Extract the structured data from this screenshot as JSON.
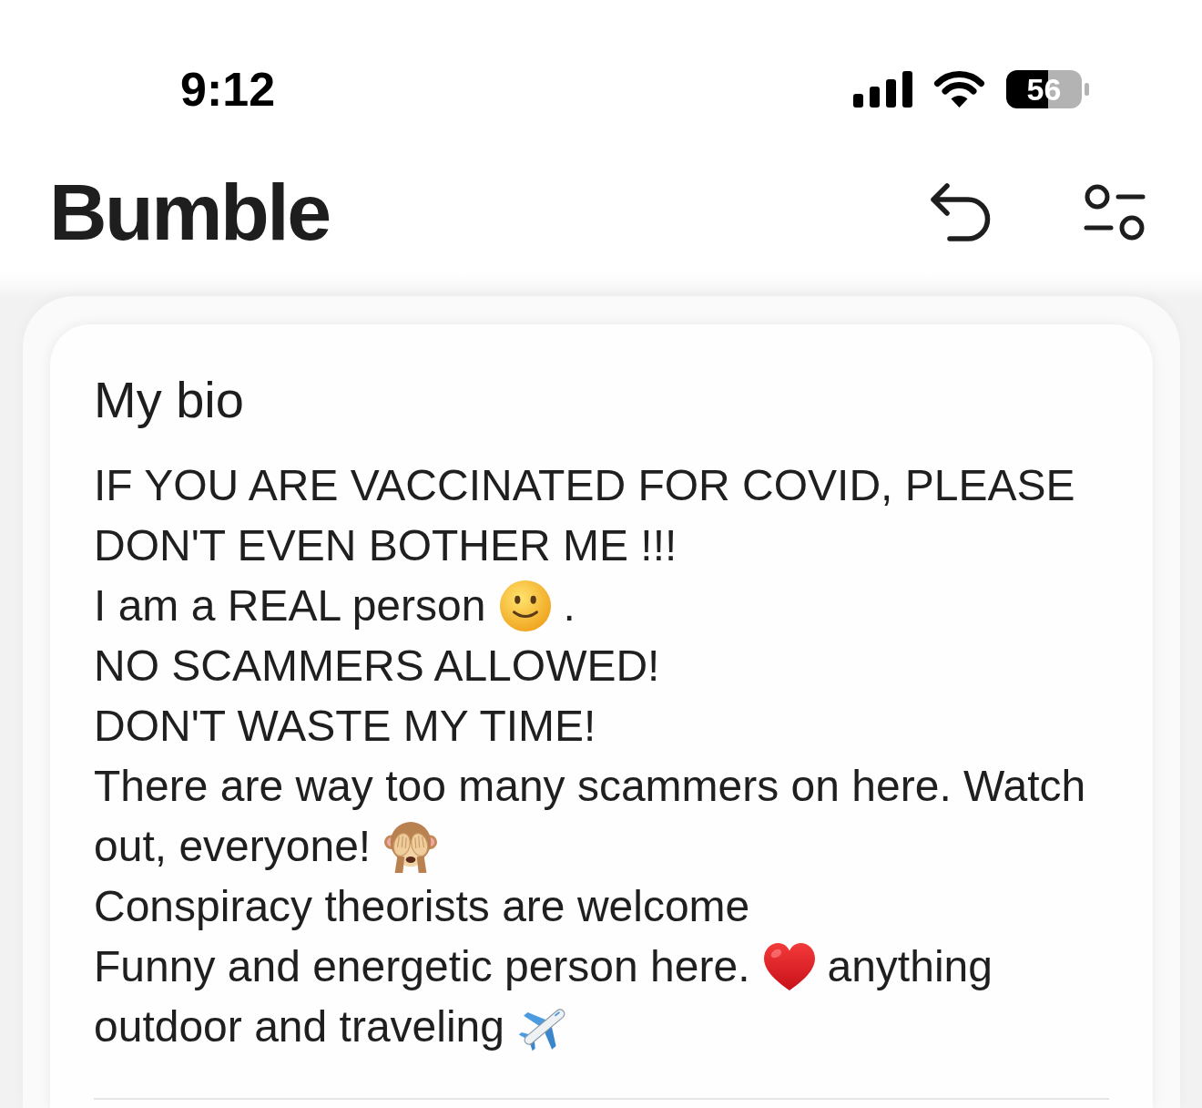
{
  "status_bar": {
    "time": "9:12",
    "battery": "56"
  },
  "header": {
    "title": "Bumble"
  },
  "bio": {
    "title": "My bio",
    "lines": [
      [
        {
          "kind": "text",
          "text": "IF YOU ARE VACCINATED FOR COVID, PLEASE"
        }
      ],
      [
        {
          "kind": "text",
          "text": "DON'T EVEN BOTHER ME !!!"
        }
      ],
      [
        {
          "kind": "text",
          "text": "I am a REAL person"
        },
        {
          "kind": "smiley"
        },
        {
          "kind": "text",
          "text": "."
        }
      ],
      [
        {
          "kind": "text",
          "text": "NO SCAMMERS ALLOWED!"
        }
      ],
      [
        {
          "kind": "text",
          "text": "DON'T WASTE MY TIME!"
        }
      ],
      [
        {
          "kind": "text",
          "text": "There are way too many scammers on here. Watch"
        }
      ],
      [
        {
          "kind": "text",
          "text": "out, everyone!"
        },
        {
          "kind": "monkey"
        }
      ],
      [
        {
          "kind": "text",
          "text": "Conspiracy theorists are welcome"
        }
      ],
      [
        {
          "kind": "text",
          "text": "Funny and energetic person here."
        },
        {
          "kind": "heart"
        },
        {
          "kind": "text",
          "text": "anything"
        }
      ],
      [
        {
          "kind": "text",
          "text": "outdoor and traveling"
        },
        {
          "kind": "airplane"
        }
      ]
    ]
  }
}
